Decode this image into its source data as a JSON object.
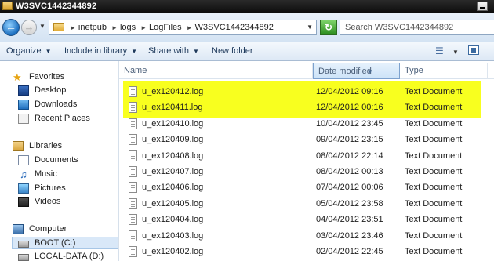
{
  "window": {
    "title": "W3SVC1442344892"
  },
  "address": {
    "breadcrumbs": [
      "inetpub",
      "logs",
      "LogFiles",
      "W3SVC1442344892"
    ],
    "search_placeholder": "Search W3SVC1442344892"
  },
  "toolbar": {
    "organize": "Organize",
    "include_in_library": "Include in library",
    "share_with": "Share with",
    "new_folder": "New folder"
  },
  "nav": {
    "favorites": "Favorites",
    "desktop": "Desktop",
    "downloads": "Downloads",
    "recent_places": "Recent Places",
    "libraries": "Libraries",
    "documents": "Documents",
    "music": "Music",
    "pictures": "Pictures",
    "videos": "Videos",
    "computer": "Computer",
    "boot": "BOOT (C:)",
    "local_data": "LOCAL-DATA (D:)"
  },
  "columns": {
    "name": "Name",
    "date": "Date modified",
    "type": "Type"
  },
  "files": [
    {
      "name": "u_ex120412.log",
      "date": "12/04/2012 09:16",
      "type": "Text Document",
      "highlighted": true
    },
    {
      "name": "u_ex120411.log",
      "date": "12/04/2012 00:16",
      "type": "Text Document",
      "highlighted": true
    },
    {
      "name": "u_ex120410.log",
      "date": "10/04/2012 23:45",
      "type": "Text Document",
      "highlighted": false
    },
    {
      "name": "u_ex120409.log",
      "date": "09/04/2012 23:15",
      "type": "Text Document",
      "highlighted": false
    },
    {
      "name": "u_ex120408.log",
      "date": "08/04/2012 22:14",
      "type": "Text Document",
      "highlighted": false
    },
    {
      "name": "u_ex120407.log",
      "date": "08/04/2012 00:13",
      "type": "Text Document",
      "highlighted": false
    },
    {
      "name": "u_ex120406.log",
      "date": "07/04/2012 00:06",
      "type": "Text Document",
      "highlighted": false
    },
    {
      "name": "u_ex120405.log",
      "date": "05/04/2012 23:58",
      "type": "Text Document",
      "highlighted": false
    },
    {
      "name": "u_ex120404.log",
      "date": "04/04/2012 23:51",
      "type": "Text Document",
      "highlighted": false
    },
    {
      "name": "u_ex120403.log",
      "date": "03/04/2012 23:46",
      "type": "Text Document",
      "highlighted": false
    },
    {
      "name": "u_ex120402.log",
      "date": "02/04/2012 22:45",
      "type": "Text Document",
      "highlighted": false
    }
  ],
  "colors": {
    "highlight": "#f8ff1f"
  }
}
